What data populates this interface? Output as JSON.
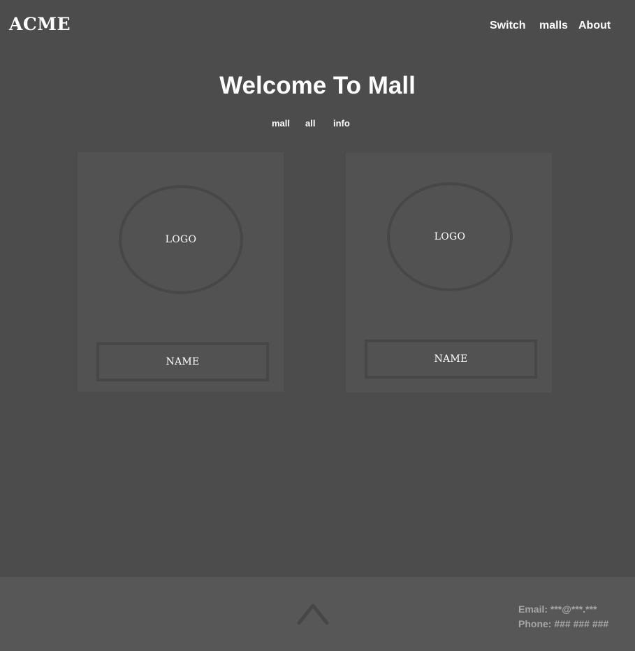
{
  "header": {
    "brand": "ACME",
    "nav": [
      {
        "label": "Switch"
      },
      {
        "label": "malls"
      },
      {
        "label": "About"
      }
    ]
  },
  "main": {
    "title": "Welcome To Mall",
    "subnav": [
      {
        "label": "mall"
      },
      {
        "label": "all"
      },
      {
        "label": "info"
      }
    ],
    "cards": [
      {
        "logo": "LOGO",
        "name": "NAME"
      },
      {
        "logo": "LOGO",
        "name": "NAME"
      }
    ]
  },
  "footer": {
    "up_icon": "chevron-up-icon",
    "email": "Email: ***@***.***",
    "phone": "Phone: ### ### ###"
  },
  "colors": {
    "background": "#4c4c4c",
    "card": "#525252",
    "footer": "#575757",
    "contact_text": "#a6a6a6"
  }
}
